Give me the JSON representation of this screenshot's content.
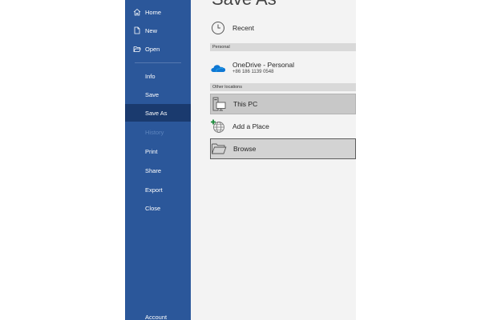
{
  "nav": {
    "items": [
      {
        "label": "Home",
        "icon": "home-icon"
      },
      {
        "label": "New",
        "icon": "new-document-icon"
      },
      {
        "label": "Open",
        "icon": "folder-open-icon"
      },
      {
        "label": "Info"
      },
      {
        "label": "Save"
      },
      {
        "label": "Save As",
        "selected": true
      },
      {
        "label": "History",
        "disabled": true
      },
      {
        "label": "Print"
      },
      {
        "label": "Share"
      },
      {
        "label": "Export"
      },
      {
        "label": "Close"
      }
    ],
    "account_label": "Account"
  },
  "page": {
    "title": "Save As"
  },
  "locations": {
    "recent_label": "Recent",
    "personal_header": "Personal",
    "onedrive_label": "OneDrive - Personal",
    "onedrive_account": "+86 186 1139 0548",
    "other_header": "Other locations",
    "this_pc_label": "This PC",
    "add_place_label": "Add a Place",
    "browse_label": "Browse"
  },
  "colors": {
    "nav_background": "#2b579a",
    "nav_selected": "#1a3a6e",
    "content_background": "#f3f3f3",
    "onedrive_blue": "#0f78d4"
  }
}
